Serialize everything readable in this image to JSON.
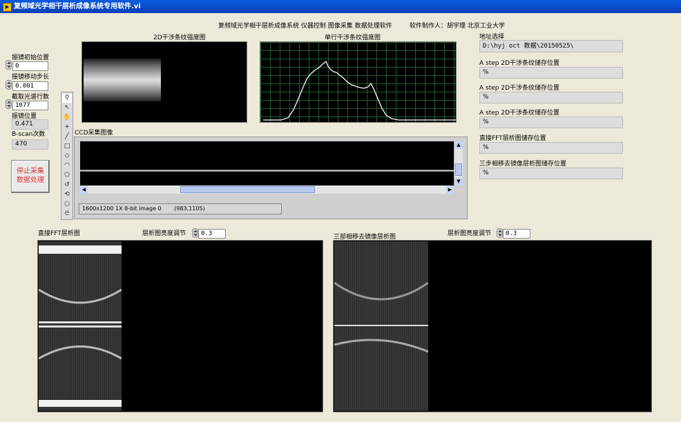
{
  "window": {
    "title": "复频域光学相干层析成像系统专用软件.vi"
  },
  "header": {
    "caption": "复频域光学相干层析成像系统 仪器控制 图像采集 数据处理软件",
    "author": "软件制作人：胡宇理 北京工业大学"
  },
  "left": {
    "mirror_start_label": "振镜初始位置",
    "mirror_start_value": "0",
    "mirror_step_label": "振镜移动步长",
    "mirror_step_value": "0.001",
    "rows_label": "截取光谱行数",
    "rows_value": "1077",
    "mirror_pos_label": "振镜位置",
    "mirror_pos_value": "0.471",
    "bscan_label": "B-scan次数",
    "bscan_value": "470",
    "stop_button_label": "停止采集\n数据处理",
    "stop_line1": "停止采集",
    "stop_line2": "数据处理"
  },
  "graphs": {
    "fringe2d_title": "2D干涉条纹强度图",
    "fringe1d_title": "单行干涉条纹强度图",
    "ccd_title": "CCD采集图像",
    "ccd_status": "1600x1200 1X 8-bit image 0",
    "ccd_coords": "(983,1105)",
    "fft_title": "直接FFT层析图",
    "fft_brightness_label": "层析图亮度调节",
    "fft_brightness_value": "0.3",
    "three_step_title": "三部相移去镜像层析图",
    "three_step_brightness_label": "层析图亮度调节",
    "three_step_brightness_value": "0.3"
  },
  "right": {
    "address_label": "地址选择",
    "address_value": "D:\\hyj oct 数据\\20150525\\",
    "a_step1_label": "A step 2D干涉条纹储存位置",
    "a_step1_value": "%",
    "a_step2_label": "A step 2D干涉条纹储存位置",
    "a_step2_value": "%",
    "a_step3_label": "A step 2D干涉条纹储存位置",
    "a_step3_value": "%",
    "fft_save_label": "直接FFT层析图储存位置",
    "fft_save_value": "%",
    "three_step_save_label": "三步相移去镜像层析图储存位置",
    "three_step_save_value": "%"
  },
  "tools": [
    "zoom-icon",
    "pointer-icon",
    "pan-icon",
    "crosshair-icon",
    "line-icon",
    "rectangle-icon",
    "rotated-rect-icon",
    "annulus-icon",
    "polygon-icon",
    "freehand-icon",
    "broken-line-icon",
    "oval-icon",
    "freehand-region-icon"
  ],
  "colors": {
    "titlebar": "#0a4fd0",
    "grid": "#1f5f2f",
    "stop_text": "#e03030"
  }
}
